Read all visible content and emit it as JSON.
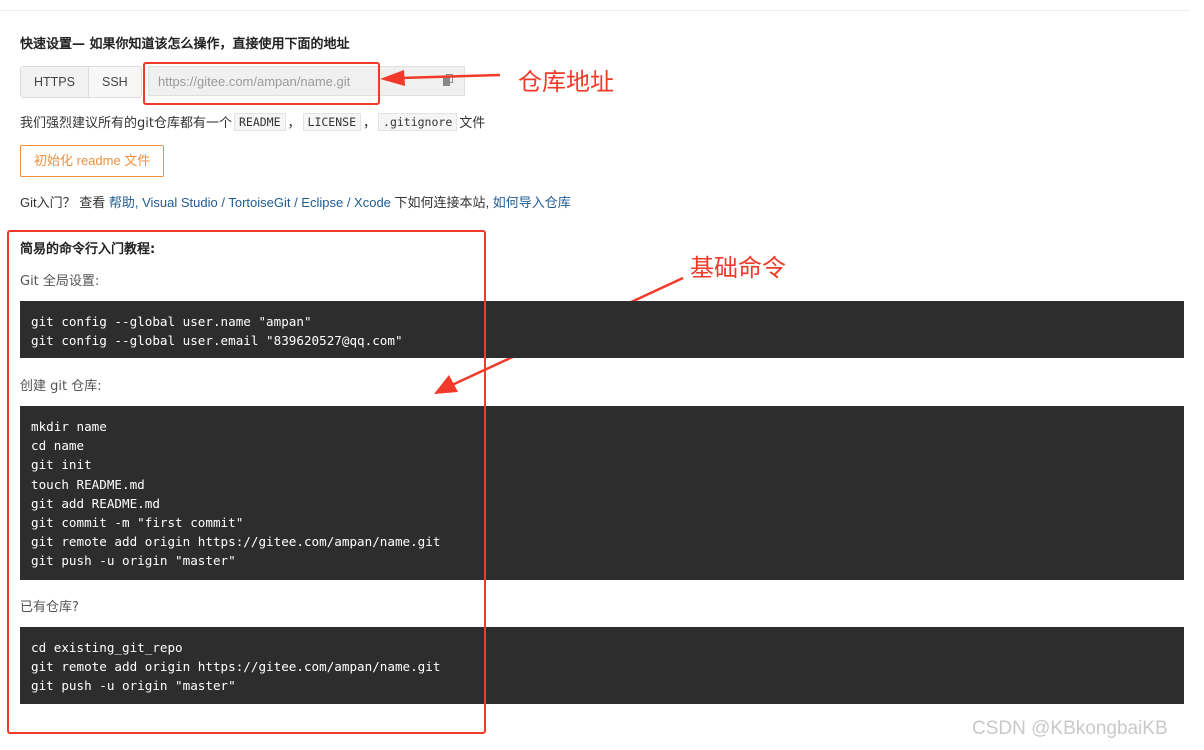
{
  "quick_setup": {
    "title": "快速设置— 如果你知道该怎么操作，直接使用下面的地址",
    "protocols": [
      "HTTPS",
      "SSH"
    ],
    "url": "https://gitee.com/ampan/name.git"
  },
  "annotations": {
    "repo_address": "仓库地址",
    "basic_commands": "基础命令",
    "color": "#f23a2a"
  },
  "recommend": {
    "prefix": "我们强烈建议所有的git仓库都有一个",
    "chips": [
      "README",
      "LICENSE",
      ".gitignore"
    ],
    "sep": "，",
    "suffix": "文件"
  },
  "init_button": {
    "label": "初始化 readme 文件",
    "color": "#f0903e"
  },
  "getting_started": {
    "prefix": "Git入门？ 查看 ",
    "help": "帮助",
    "sep1": ", ",
    "tools": "Visual Studio / TortoiseGit / Eclipse / Xcode",
    "middle": " 下如何连接本站, ",
    "import": "如何导入仓库"
  },
  "tutorial": {
    "title": "简易的命令行入门教程:",
    "sections": [
      {
        "label": "Git 全局设置:",
        "lines": [
          "git config --global user.name \"ampan\"",
          "git config --global user.email \"839620527@qq.com\""
        ]
      },
      {
        "label": "创建 git 仓库:",
        "lines": [
          "mkdir name",
          "cd name",
          "git init",
          "touch README.md",
          "git add README.md",
          "git commit -m \"first commit\"",
          "git remote add origin https://gitee.com/ampan/name.git",
          "git push -u origin \"master\""
        ]
      },
      {
        "label": "已有仓库?",
        "lines": [
          "cd existing_git_repo",
          "git remote add origin https://gitee.com/ampan/name.git",
          "git push -u origin \"master\""
        ]
      }
    ]
  },
  "watermark": "CSDN @KBkongbaiKB"
}
